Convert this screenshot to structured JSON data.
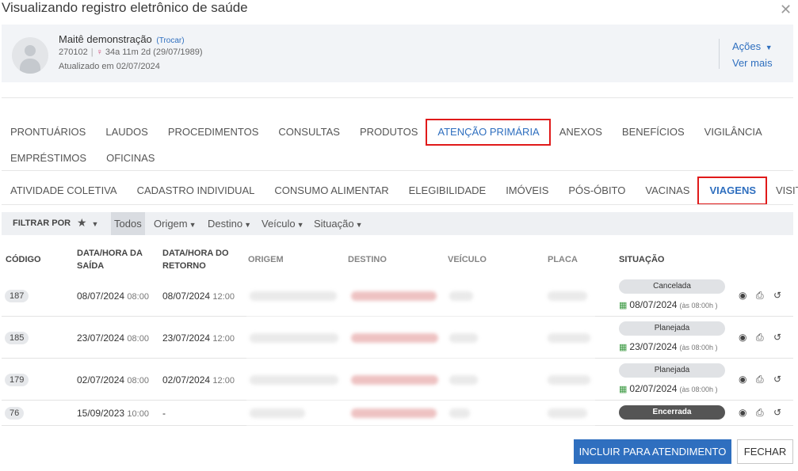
{
  "window": {
    "title": "Visualizando registro eletrônico de saúde",
    "close_icon": "close-icon"
  },
  "patient": {
    "name": "Maitê demonstração",
    "switch_label": "(Trocar)",
    "id": "270102",
    "age": "34a 11m 2d (29/07/1989)",
    "updated": "Atualizado em 02/07/2024",
    "actions_label": "Ações",
    "more_label": "Ver mais"
  },
  "tabs_main": [
    "PRONTUÁRIOS",
    "LAUDOS",
    "PROCEDIMENTOS",
    "CONSULTAS",
    "PRODUTOS",
    "ATENÇÃO PRIMÁRIA",
    "ANEXOS",
    "BENEFÍCIOS",
    "VIGILÂNCIA",
    "EMPRÉSTIMOS",
    "OFICINAS"
  ],
  "tabs_sub": [
    "ATIVIDADE COLETIVA",
    "CADASTRO INDIVIDUAL",
    "CONSUMO ALIMENTAR",
    "ELEGIBILIDADE",
    "IMÓVEIS",
    "PÓS-ÓBITO",
    "VACINAS",
    "VIAGENS",
    "VISITAS"
  ],
  "filters": {
    "label": "FILTRAR POR",
    "all": "Todos",
    "origin": "Origem",
    "destination": "Destino",
    "vehicle": "Veículo",
    "status": "Situação"
  },
  "table": {
    "headers": {
      "code": "CÓDIGO",
      "departure_1": "DATA/HORA DA",
      "departure_2": "SAÍDA",
      "return_1": "DATA/HORA DO",
      "return_2": "RETORNO",
      "origin": "ORIGEM",
      "destination": "DESTINO",
      "vehicle": "VEÍCULO",
      "plate": "PLACA",
      "status": "SITUAÇÃO"
    },
    "rows": [
      {
        "code": "187",
        "dep_date": "08/07/2024",
        "dep_time": "08:00",
        "ret_date": "08/07/2024",
        "ret_time": "12:00",
        "status": "Cancelada",
        "sdate": "08/07/2024",
        "stime": "(às 08:00h )"
      },
      {
        "code": "185",
        "dep_date": "23/07/2024",
        "dep_time": "08:00",
        "ret_date": "23/07/2024",
        "ret_time": "12:00",
        "status": "Planejada",
        "sdate": "23/07/2024",
        "stime": "(às 08:00h )"
      },
      {
        "code": "179",
        "dep_date": "02/07/2024",
        "dep_time": "08:00",
        "ret_date": "02/07/2024",
        "ret_time": "12:00",
        "status": "Planejada",
        "sdate": "02/07/2024",
        "stime": "(às 08:00h )"
      },
      {
        "code": "76",
        "dep_date": "15/09/2023",
        "dep_time": "10:00",
        "ret_date": "-",
        "ret_time": "",
        "status": "Encerrada",
        "sdate": "",
        "stime": ""
      }
    ]
  },
  "buttons": {
    "include": "INCLUIR PARA ATENDIMENTO",
    "close": "FECHAR"
  },
  "colors": {
    "accent": "#2f6fbf",
    "highlight": "#e01a1a",
    "cal": "#3c9a43"
  }
}
